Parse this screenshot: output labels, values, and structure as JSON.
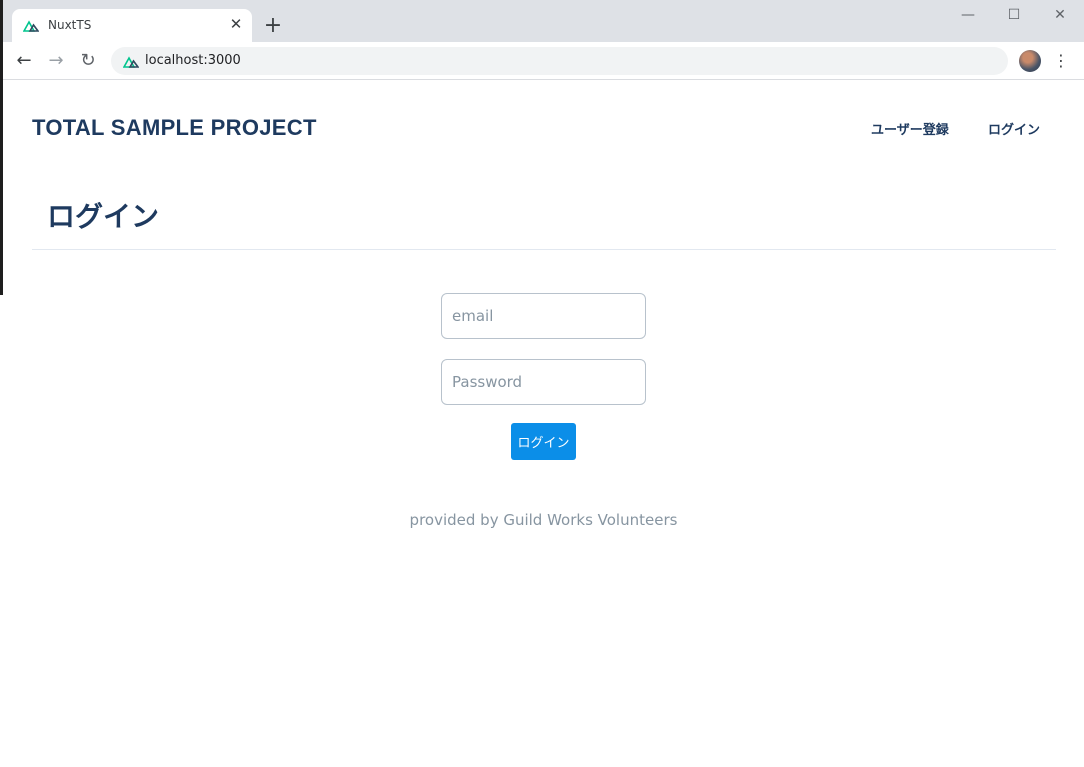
{
  "browser": {
    "tab_title": "NuxtTS",
    "url": "localhost:3000",
    "new_tab_symbol": "+",
    "close_tab_symbol": "✕"
  },
  "header": {
    "brand": "TOTAL SAMPLE PROJECT",
    "nav": {
      "register_label": "ユーザー登録",
      "login_label": "ログイン"
    }
  },
  "main": {
    "heading": "ログイン",
    "email_placeholder": "email",
    "password_placeholder": "Password",
    "submit_label": "ログイン",
    "footer_text": "provided by Guild Works Volunteers"
  },
  "colors": {
    "brand_text": "#1e3a5f",
    "primary_button": "#0b8ee8",
    "nuxt_green": "#00c58e"
  },
  "icons": {
    "favicon": "nuxt-logo-icon",
    "back": "arrow-left-icon",
    "forward": "arrow-right-icon",
    "reload": "reload-icon",
    "menu": "more-vertical-icon"
  }
}
